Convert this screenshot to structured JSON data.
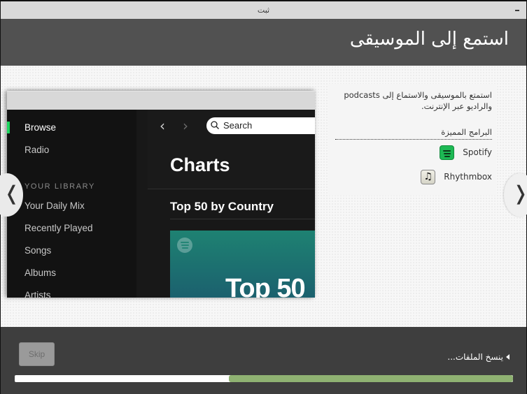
{
  "window": {
    "title": "ثبت",
    "minimize_label": "Minimize"
  },
  "header": {
    "title": "استمع إلى الموسيقى"
  },
  "slide": {
    "description": "استمتع بالموسيقى والاستماع إلى podcasts والراديو عبر الإنترنت.",
    "featured_heading": "البرامج المميزة",
    "apps": [
      {
        "name": "Spotify",
        "icon": "spotify-icon",
        "color": "#1db954"
      },
      {
        "name": "Rhythmbox",
        "icon": "music-note-icon",
        "glyph": "♫"
      }
    ],
    "prev_glyph": "❬",
    "next_glyph": "❭",
    "preview": {
      "sidebar": {
        "items": [
          {
            "label": "Browse",
            "active": true
          },
          {
            "label": "Radio",
            "active": false
          }
        ],
        "section_label": "YOUR LIBRARY",
        "library_items": [
          "Your Daily Mix",
          "Recently Played",
          "Songs",
          "Albums",
          "Artists"
        ]
      },
      "nav_back_glyph": "‹",
      "nav_forward_glyph": "›",
      "search_placeholder": "Search",
      "page_title": "Charts",
      "section_title": "Top 50 by Country",
      "card_title": "Top 50",
      "accent_color": "#1ed760"
    }
  },
  "footer": {
    "skip_label": "Skip",
    "status_text": "ينسخ الملفات...",
    "progress_percent": 57,
    "progress_color": "#8fb272"
  }
}
